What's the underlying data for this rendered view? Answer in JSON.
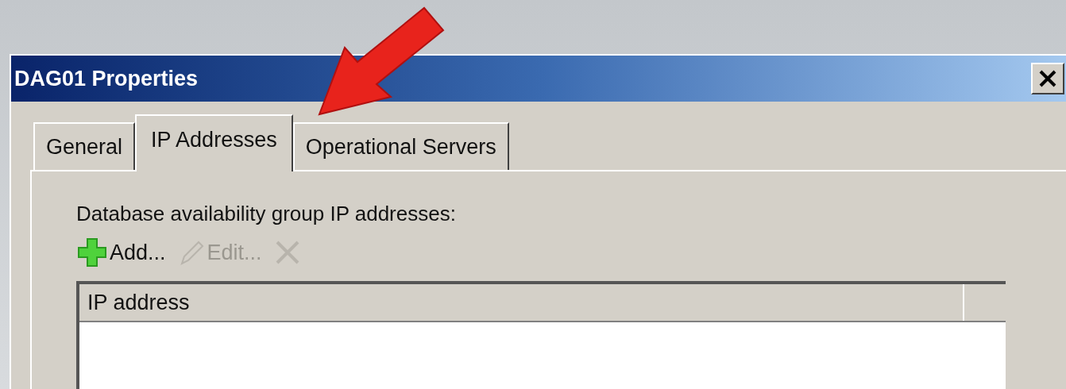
{
  "window": {
    "title": "DAG01 Properties"
  },
  "tabs": [
    {
      "label": "General",
      "selected": false
    },
    {
      "label": "IP Addresses",
      "selected": true
    },
    {
      "label": "Operational Servers",
      "selected": false
    }
  ],
  "section_label": "Database availability group IP addresses:",
  "toolbar": [
    {
      "kind": "add",
      "label": "Add...",
      "disabled": false
    },
    {
      "kind": "edit",
      "label": "Edit...",
      "disabled": true
    },
    {
      "kind": "remove",
      "disabled": true
    }
  ],
  "list": {
    "columns": [
      "IP address"
    ]
  }
}
